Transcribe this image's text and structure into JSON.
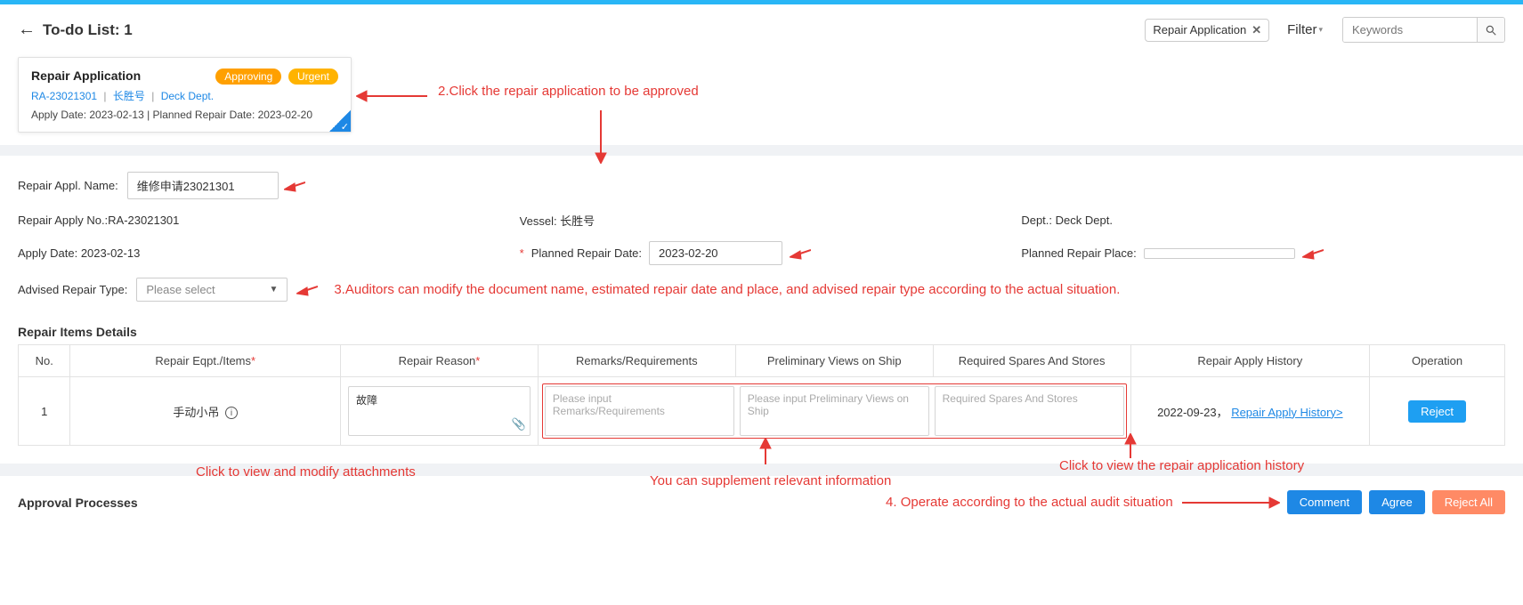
{
  "header": {
    "title": "To-do List: 1",
    "chip_label": "Repair Application",
    "filter_label": "Filter",
    "search_placeholder": "Keywords"
  },
  "card": {
    "title": "Repair Application",
    "badge_approving": "Approving",
    "badge_urgent": "Urgent",
    "ref": "RA-23021301",
    "vessel": "长胜号",
    "dept": "Deck Dept.",
    "line3": "Apply Date:  2023-02-13 | Planned Repair Date:  2023-02-20"
  },
  "form": {
    "repair_appl_name_lbl": "Repair Appl. Name:",
    "repair_appl_name_val": "维修申请23021301",
    "apply_no_lbl": "Repair Apply No.:RA-23021301",
    "vessel_lbl": "Vessel: 长胜号",
    "dept_lbl": "Dept.: Deck Dept.",
    "apply_date_lbl": "Apply Date: 2023-02-13",
    "planned_date_lbl": "Planned Repair Date:",
    "planned_date_val": "2023-02-20",
    "planned_place_lbl": "Planned Repair Place:",
    "planned_place_val": "",
    "advised_type_lbl": "Advised Repair Type:",
    "advised_type_ph": "Please select"
  },
  "table": {
    "title": "Repair Items Details",
    "h_no": "No.",
    "h_eq": "Repair Eqpt./Items",
    "h_reason": "Repair Reason",
    "h_remarks": "Remarks/Requirements",
    "h_prelim": "Preliminary Views on Ship",
    "h_spares": "Required Spares And Stores",
    "h_history": "Repair Apply History",
    "h_op": "Operation",
    "rows": [
      {
        "no": "1",
        "eq": "手动小吊",
        "reason": "故障",
        "remarks_ph": "Please input Remarks/Requirements",
        "prelim_ph": "Please input Preliminary Views on Ship",
        "spares_ph": "Required Spares And Stores",
        "history_date": "2022-09-23，",
        "history_link": "Repair Apply History>",
        "op_reject": "Reject"
      }
    ]
  },
  "approval": {
    "title": "Approval Processes",
    "comment": "Comment",
    "agree": "Agree",
    "reject_all": "Reject All"
  },
  "anno": {
    "a2": "2.Click the repair application to be approved",
    "a3": "3.Auditors can modify the document name, estimated repair date and place, and advised repair type according to the actual situation.",
    "attach": "Click to view and modify attachments",
    "supp": "You can supplement relevant information",
    "hist": "Click to view the repair application history",
    "a4": "4. Operate according to the actual audit situation"
  }
}
